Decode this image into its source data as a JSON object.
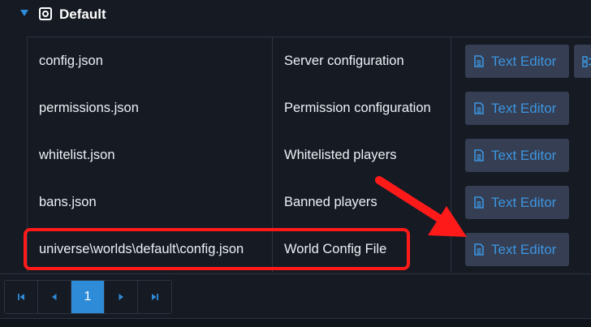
{
  "section": {
    "title": "Default"
  },
  "rows": [
    {
      "file": "config.json",
      "description": "Server configuration",
      "action": "Text Editor"
    },
    {
      "file": "permissions.json",
      "description": "Permission configuration",
      "action": "Text Editor"
    },
    {
      "file": "whitelist.json",
      "description": "Whitelisted players",
      "action": "Text Editor"
    },
    {
      "file": "bans.json",
      "description": "Banned players",
      "action": "Text Editor"
    },
    {
      "file": "universe\\worlds\\default\\config.json",
      "description": "World Config File",
      "action": "Text Editor"
    }
  ],
  "pagination": {
    "current_page": "1"
  },
  "colors": {
    "background": "#151a23",
    "button_bg": "#353e52",
    "button_text": "#3d95e0",
    "active_page": "#2e8bd8",
    "annotation": "#ff1a1a"
  },
  "icons": {
    "expand": "caret-down-icon",
    "section": "gear-icon",
    "editor": "file-text-icon",
    "extra": "form-icon",
    "first": "first-page-icon",
    "prev": "prev-page-icon",
    "next": "next-page-icon",
    "last": "last-page-icon"
  }
}
